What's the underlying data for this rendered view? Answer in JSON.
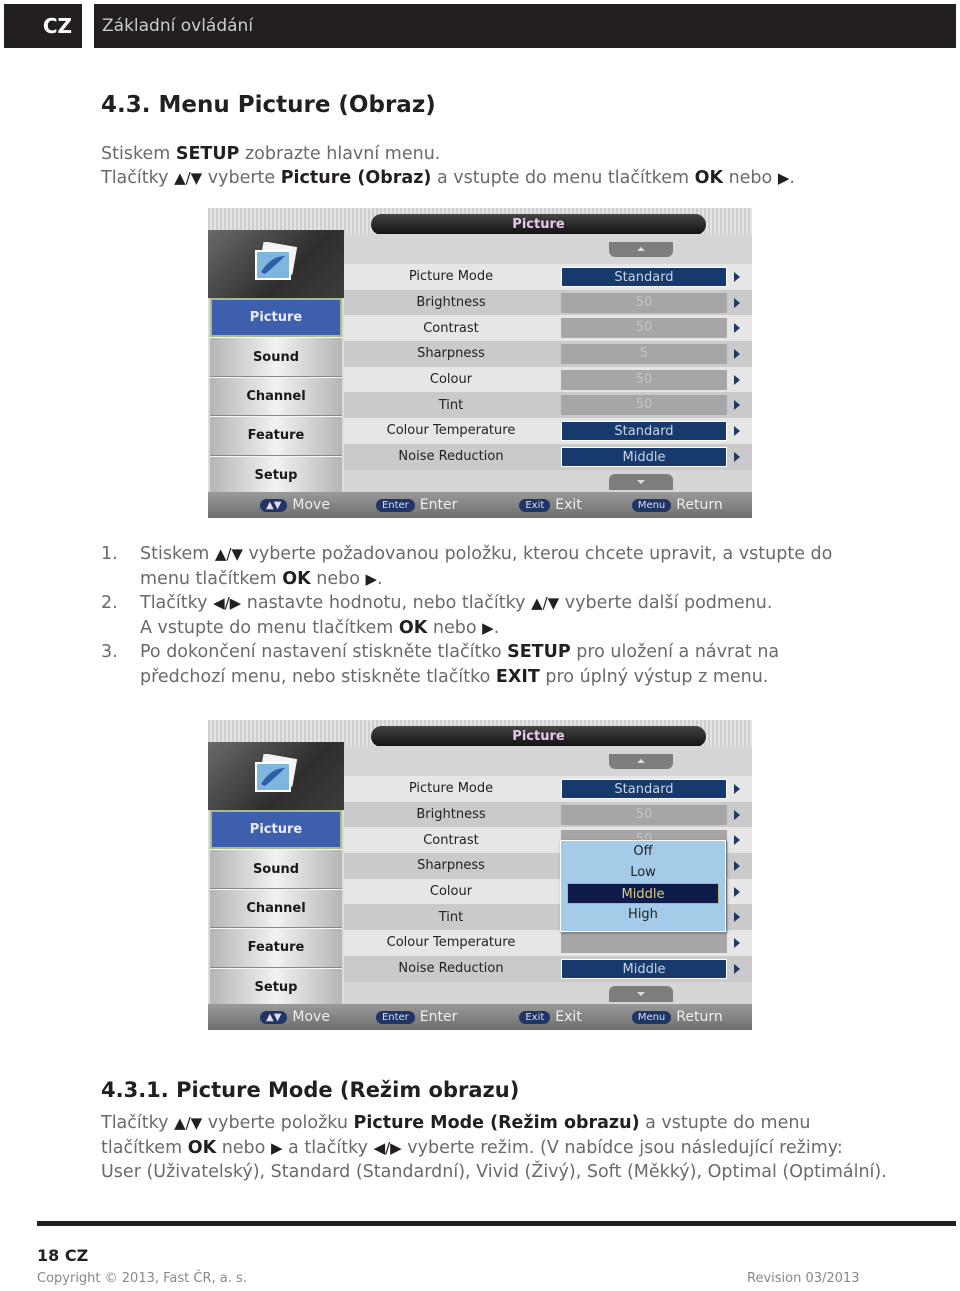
{
  "header": {
    "lang": "CZ",
    "title": "Základní ovládání"
  },
  "section": {
    "title": "4.3. Menu Picture (Obraz)",
    "intro_line1": {
      "pre": "Stiskem ",
      "bold": "SETUP",
      "post": " zobrazte hlavní menu."
    },
    "intro_line2": {
      "pre": "Tlačítky ",
      "arrows": "▲/▼",
      "mid": " vyberte ",
      "bold": "Picture (Obraz)",
      "mid2": " a vstupte do menu tlačítkem ",
      "bold2": "OK",
      "post": " nebo ",
      "arrow": "▶",
      "end": "."
    }
  },
  "steps": [
    {
      "num": "1.",
      "l1_pre": "Stiskem ",
      "l1_arrows": "▲/▼",
      "l1_post": " vyberte požadovanou položku, kterou chcete upravit, a vstupte do",
      "l2_pre": "menu tlačítkem ",
      "l2_bold": "OK",
      "l2_post": " nebo ",
      "l2_arrow": "▶",
      "l2_end": "."
    },
    {
      "num": "2.",
      "l1_pre": "Tlačítky ",
      "l1_arrows": "◀/▶",
      "l1_mid": " nastavte hodnotu, nebo tlačítky ",
      "l1_arrows2": "▲/▼",
      "l1_post": " vyberte další podmenu.",
      "l2_pre": "A vstupte do menu tlačítkem ",
      "l2_bold": "OK",
      "l2_post": " nebo ",
      "l2_arrow": "▶",
      "l2_end": "."
    },
    {
      "num": "3.",
      "l1_pre": "Po dokončení nastavení stiskněte tlačítko ",
      "l1_bold": "SETUP",
      "l1_post": " pro uložení a návrat na",
      "l2_pre": "předchozí menu, nebo stiskněte tlačítko ",
      "l2_bold": "EXIT",
      "l2_post": " pro úplný výstup z menu."
    }
  ],
  "tv_menu": {
    "title": "Picture",
    "categories": [
      {
        "label": "Picture",
        "active": true
      },
      {
        "label": "Sound",
        "active": false
      },
      {
        "label": "Channel",
        "active": false
      },
      {
        "label": "Feature",
        "active": false
      },
      {
        "label": "Setup",
        "active": false
      }
    ],
    "items": [
      {
        "label": "Picture Mode",
        "value": "Standard",
        "selectable": true
      },
      {
        "label": "Brightness",
        "value": "50",
        "selectable": false
      },
      {
        "label": "Contrast",
        "value": "50",
        "selectable": false
      },
      {
        "label": "Sharpness",
        "value": "5",
        "selectable": false
      },
      {
        "label": "Colour",
        "value": "50",
        "selectable": false
      },
      {
        "label": "Tint",
        "value": "50",
        "selectable": false
      },
      {
        "label": "Colour Temperature",
        "value": "Standard",
        "selectable": true
      },
      {
        "label": "Noise Reduction",
        "value": "Middle",
        "selectable": true
      }
    ],
    "footer": [
      {
        "key": "▲▼",
        "label": "Move"
      },
      {
        "key": "Enter",
        "label": "Enter"
      },
      {
        "key": "Exit",
        "label": "Exit"
      },
      {
        "key": "Menu",
        "label": "Return"
      }
    ],
    "popup_options": [
      "Off",
      "Low",
      "Middle",
      "High"
    ],
    "popup_selected": "Middle"
  },
  "subsection": {
    "title": "4.3.1. Picture Mode (Režim obrazu)",
    "l1_pre": "Tlačítky ",
    "l1_arrows": "▲/▼",
    "l1_mid": " vyberte položku ",
    "l1_bold": "Picture Mode (Režim obrazu)",
    "l1_post": " a vstupte do menu",
    "l2_pre": "tlačítkem ",
    "l2_bold": "OK",
    "l2_mid": " nebo ",
    "l2_arrow": "▶",
    "l2_mid2": " a tlačítky ",
    "l2_arrows": "◀/▶",
    "l2_post": " vyberte režim. (V nabídce jsou následující režimy:",
    "l3": "User (Uživatelský), Standard (Standardní), Vivid (Živý), Soft (Měkký), Optimal (Optimální)."
  },
  "footer": {
    "page": "18 CZ",
    "copyright": "Copyright © 2013, Fast ČR, a. s.",
    "revision": "Revision 03/2013"
  }
}
